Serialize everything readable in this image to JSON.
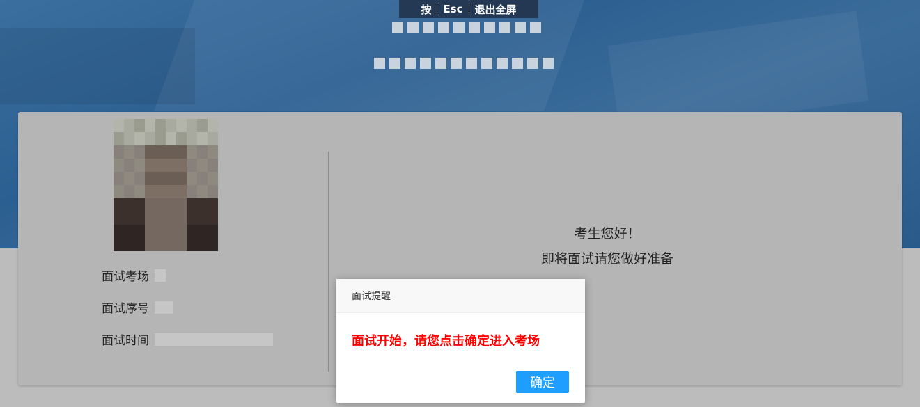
{
  "esc_hint": {
    "press": "按",
    "key": "Esc",
    "action": "退出全屏"
  },
  "candidate": {
    "labels": {
      "room": "面试考场",
      "sequence": "面试序号",
      "time": "面试时间"
    }
  },
  "welcome": {
    "greeting": "考生您好！",
    "prepare": "即将面试请您做好准备"
  },
  "dialog": {
    "title": "面试提醒",
    "message": "面试开始，请您点击确定进入考场",
    "confirm_label": "确定"
  },
  "colors": {
    "accent": "#1e9fff",
    "alert": "#ff0000",
    "banner": "#2c5f91"
  }
}
